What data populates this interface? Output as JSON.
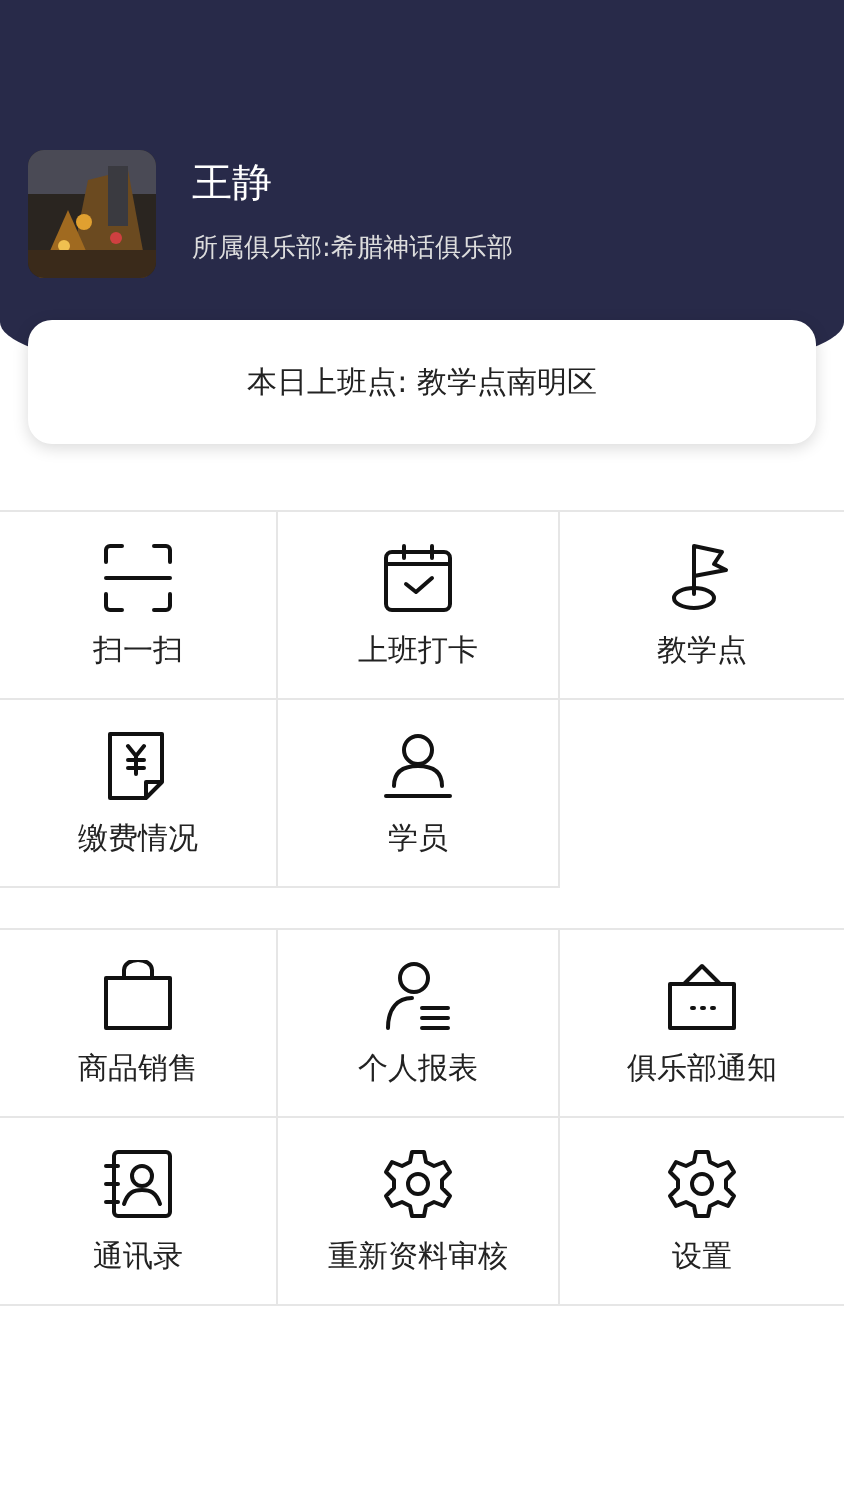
{
  "profile": {
    "name": "王静",
    "club": "所属俱乐部:希腊神话俱乐部"
  },
  "workplace": "本日上班点: 教学点南明区",
  "groups": [
    {
      "items": [
        {
          "label": "扫一扫"
        },
        {
          "label": "上班打卡"
        },
        {
          "label": "教学点"
        },
        {
          "label": "缴费情况"
        },
        {
          "label": "学员"
        }
      ]
    },
    {
      "items": [
        {
          "label": "商品销售"
        },
        {
          "label": "个人报表"
        },
        {
          "label": "俱乐部通知"
        },
        {
          "label": "通讯录"
        },
        {
          "label": "重新资料审核"
        },
        {
          "label": "设置"
        }
      ]
    }
  ]
}
